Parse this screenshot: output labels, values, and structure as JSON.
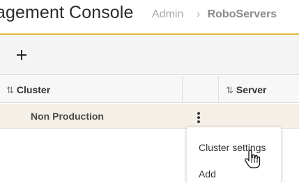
{
  "header": {
    "title": "agement Console",
    "breadcrumb": {
      "parent": "Admin",
      "separator": "›",
      "current": "RoboServers"
    },
    "accent_color": "#e5b83f"
  },
  "toolbar": {
    "add_icon": "plus-icon"
  },
  "table": {
    "columns": [
      {
        "label": "Cluster",
        "sort_icon": "⇅"
      },
      {
        "label": "",
        "sort_icon": ""
      },
      {
        "label": "Server",
        "sort_icon": "⇅"
      }
    ],
    "rows": [
      {
        "cluster": "Non Production",
        "actions_icon": "kebab-menu-icon"
      }
    ]
  },
  "context_menu": {
    "items": [
      {
        "label": "Cluster settings"
      },
      {
        "label": "Add"
      }
    ]
  }
}
